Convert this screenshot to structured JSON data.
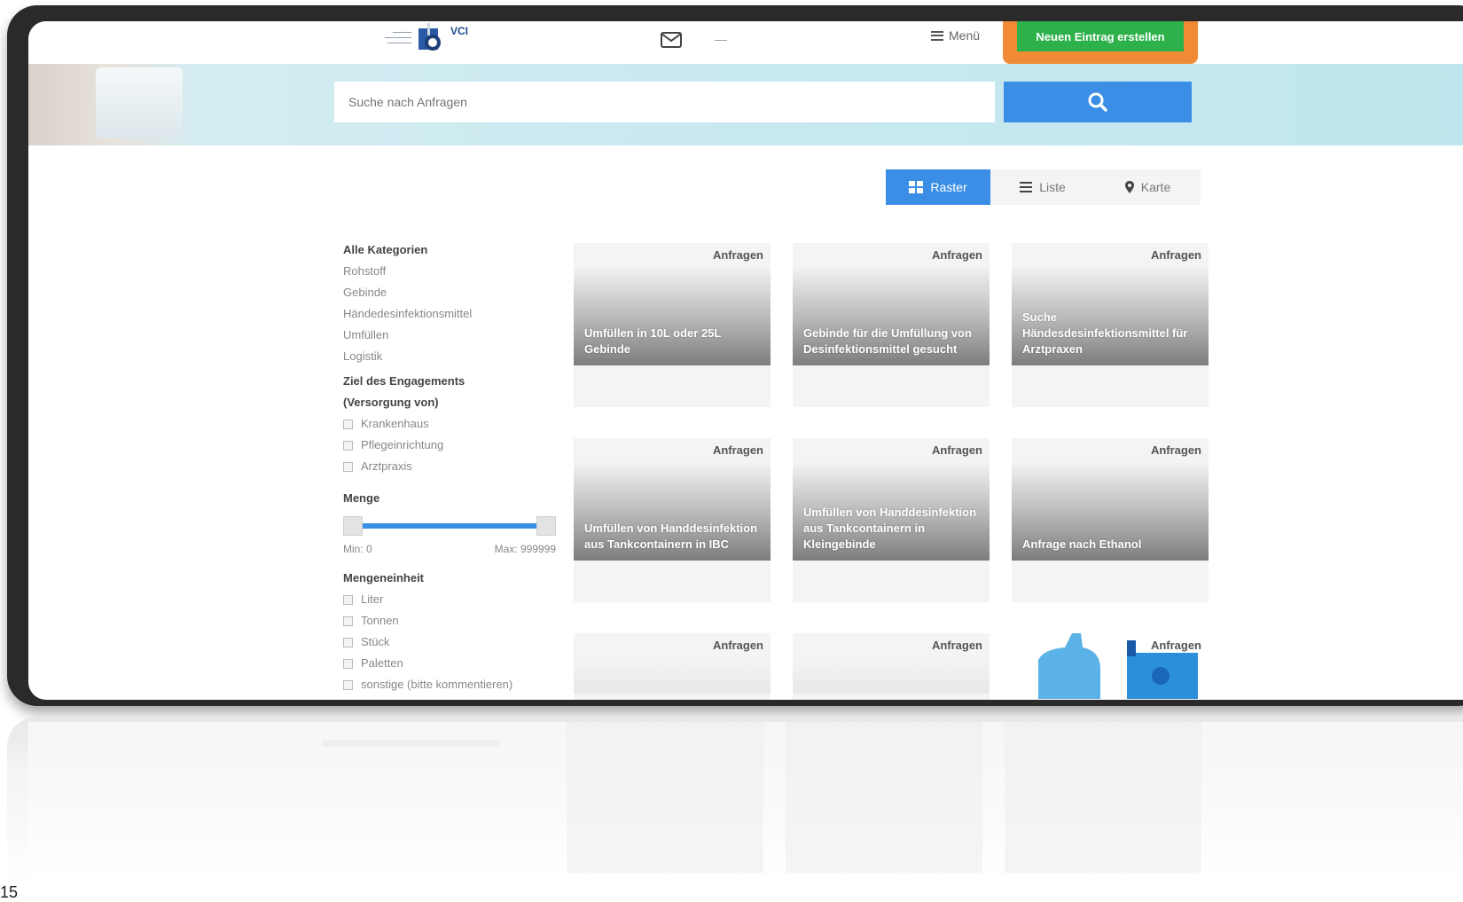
{
  "header": {
    "logo_text": "VCI",
    "menu_label": "Menü",
    "dash": "—",
    "cta_label": "Neuen Eintrag erstellen"
  },
  "search": {
    "placeholder": "Suche nach Anfragen"
  },
  "view_tabs": [
    {
      "label": "Raster",
      "icon": "grid-icon",
      "active": true
    },
    {
      "label": "Liste",
      "icon": "list-icon",
      "active": false
    },
    {
      "label": "Karte",
      "icon": "map-pin-icon",
      "active": false
    }
  ],
  "sidebar": {
    "categories_heading": "Alle Kategorien",
    "categories": [
      "Rohstoff",
      "Gebinde",
      "Händedesinfektionsmittel",
      "Umfüllen",
      "Logistik"
    ],
    "goal_heading_1": "Ziel des Engagements",
    "goal_heading_2": "(Versorgung von)",
    "goals": [
      "Krankenhaus",
      "Pflegeinrichtung",
      "Arztpraxis"
    ],
    "quantity_heading": "Menge",
    "quantity_min": "Min: 0",
    "quantity_max": "Max: 999999",
    "unit_heading": "Mengeneinheit",
    "units": [
      "Liter",
      "Tonnen",
      "Stück",
      "Paletten"
    ],
    "units_more": "sonstige (bitte kommentieren)"
  },
  "cards": [
    {
      "tag": "Anfragen",
      "title": "Umfüllen in 10L oder 25L Gebinde"
    },
    {
      "tag": "Anfragen",
      "title": "Gebinde für die Umfüllung von Desinfektionsmittel gesucht"
    },
    {
      "tag": "Anfragen",
      "title": "Suche Händesdesinfektionsmittel für Arztpraxen"
    },
    {
      "tag": "Anfragen",
      "title": "Umfüllen von Handdesinfektion aus Tankcontainern in IBC"
    },
    {
      "tag": "Anfragen",
      "title": "Umfüllen von Handdesinfektion aus Tankcontainern in Kleingebinde"
    },
    {
      "tag": "Anfragen",
      "title": "Anfrage nach Ethanol"
    },
    {
      "tag": "Anfragen",
      "title": ""
    },
    {
      "tag": "Anfragen",
      "title": ""
    },
    {
      "tag": "Anfragen",
      "title": ""
    }
  ],
  "page_number": "15",
  "colors": {
    "accent": "#3a8ee6",
    "cta": "#2db14a",
    "highlight": "#f08a34"
  }
}
